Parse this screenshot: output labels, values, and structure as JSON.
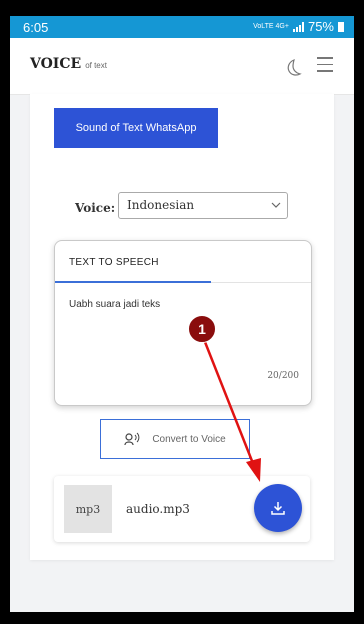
{
  "status_bar": {
    "time": "6:05",
    "network": "VoLTE 4G+",
    "battery": "75%"
  },
  "header": {
    "logo_main": "VOICE",
    "logo_sub": "of text",
    "theme_icon": "moon-icon",
    "menu_icon": "hamburger-menu-icon"
  },
  "main": {
    "whatsapp_button": "Sound of Text WhatsApp",
    "voice_label": "Voice:",
    "voice_selected": "Indonesian",
    "tts": {
      "tab_label": "TEXT TO SPEECH",
      "text": "Uabh suara jadi teks",
      "char_count": "20/200"
    },
    "convert_button": "Convert to Voice",
    "audio": {
      "format": "mp3",
      "filename": "audio.mp3",
      "download_icon": "download-icon"
    }
  },
  "annotation": {
    "step_number": "1",
    "color": "#e01212"
  },
  "colors": {
    "status_bar": "#1597d4",
    "primary": "#2d53d6",
    "accent_line": "#3b6fd8"
  }
}
